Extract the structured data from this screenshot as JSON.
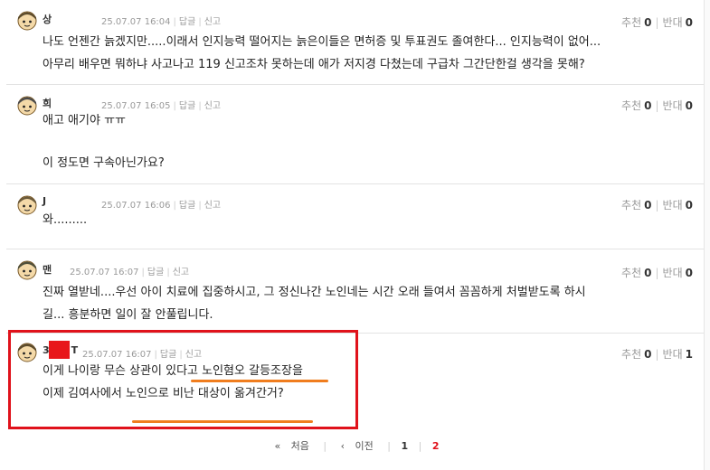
{
  "comments": [
    {
      "nick": "상",
      "date": "25.07.07 16:04",
      "reply": "답글",
      "report": "신고",
      "up_label": "추천",
      "up": "0",
      "down_label": "반대",
      "down": "0",
      "lines": [
        "나도 언젠간 늙겠지만.....이래서 인지능력 떨어지는 늙은이들은 면허증 및 투표권도 졸여한다... 인지능력이 없어...",
        "아무리 배우면 뭐하냐 사고나고 119 신고조차 못하는데 애가 저지경 다쳤는데 구급차 그간단한걸 생각을 못해?"
      ]
    },
    {
      "nick": "희",
      "date": "25.07.07 16:05",
      "reply": "답글",
      "report": "신고",
      "up_label": "추천",
      "up": "0",
      "down_label": "반대",
      "down": "0",
      "lines": [
        "애고 애기야 ㅠㅠ",
        "",
        "이 정도면 구속아닌가요?"
      ]
    },
    {
      "nick": "J",
      "date": "25.07.07 16:06",
      "reply": "답글",
      "report": "신고",
      "up_label": "추천",
      "up": "0",
      "down_label": "반대",
      "down": "0",
      "lines": [
        "와........."
      ]
    },
    {
      "nick": "맨",
      "date": "25.07.07 16:07",
      "reply": "답글",
      "report": "신고",
      "up_label": "추천",
      "up": "0",
      "down_label": "반대",
      "down": "0",
      "lines": [
        "진짜 열받네....우선 아이 치료에 집중하시고, 그 정신나간 노인네는 시간 오래 들여서 꼼꼼하게 처벌받도록 하시",
        "길... 흥분하면 일이 잘 안풀립니다."
      ]
    },
    {
      "nick_a": "3",
      "nick_b": "T",
      "date": "25.07.07 16:07",
      "reply": "답글",
      "report": "신고",
      "up_label": "추천",
      "up": "0",
      "down_label": "반대",
      "down": "1",
      "lines": [
        "이게 나이랑 무슨 상관이 있다고 노인혐오 갈등조장을",
        "",
        "이제 김여사에서 노인으로 비난 대상이 옮겨간거?"
      ]
    }
  ],
  "pagination": {
    "first": "처음",
    "prev": "이전",
    "pages": [
      "1",
      "2"
    ],
    "current": "2"
  }
}
